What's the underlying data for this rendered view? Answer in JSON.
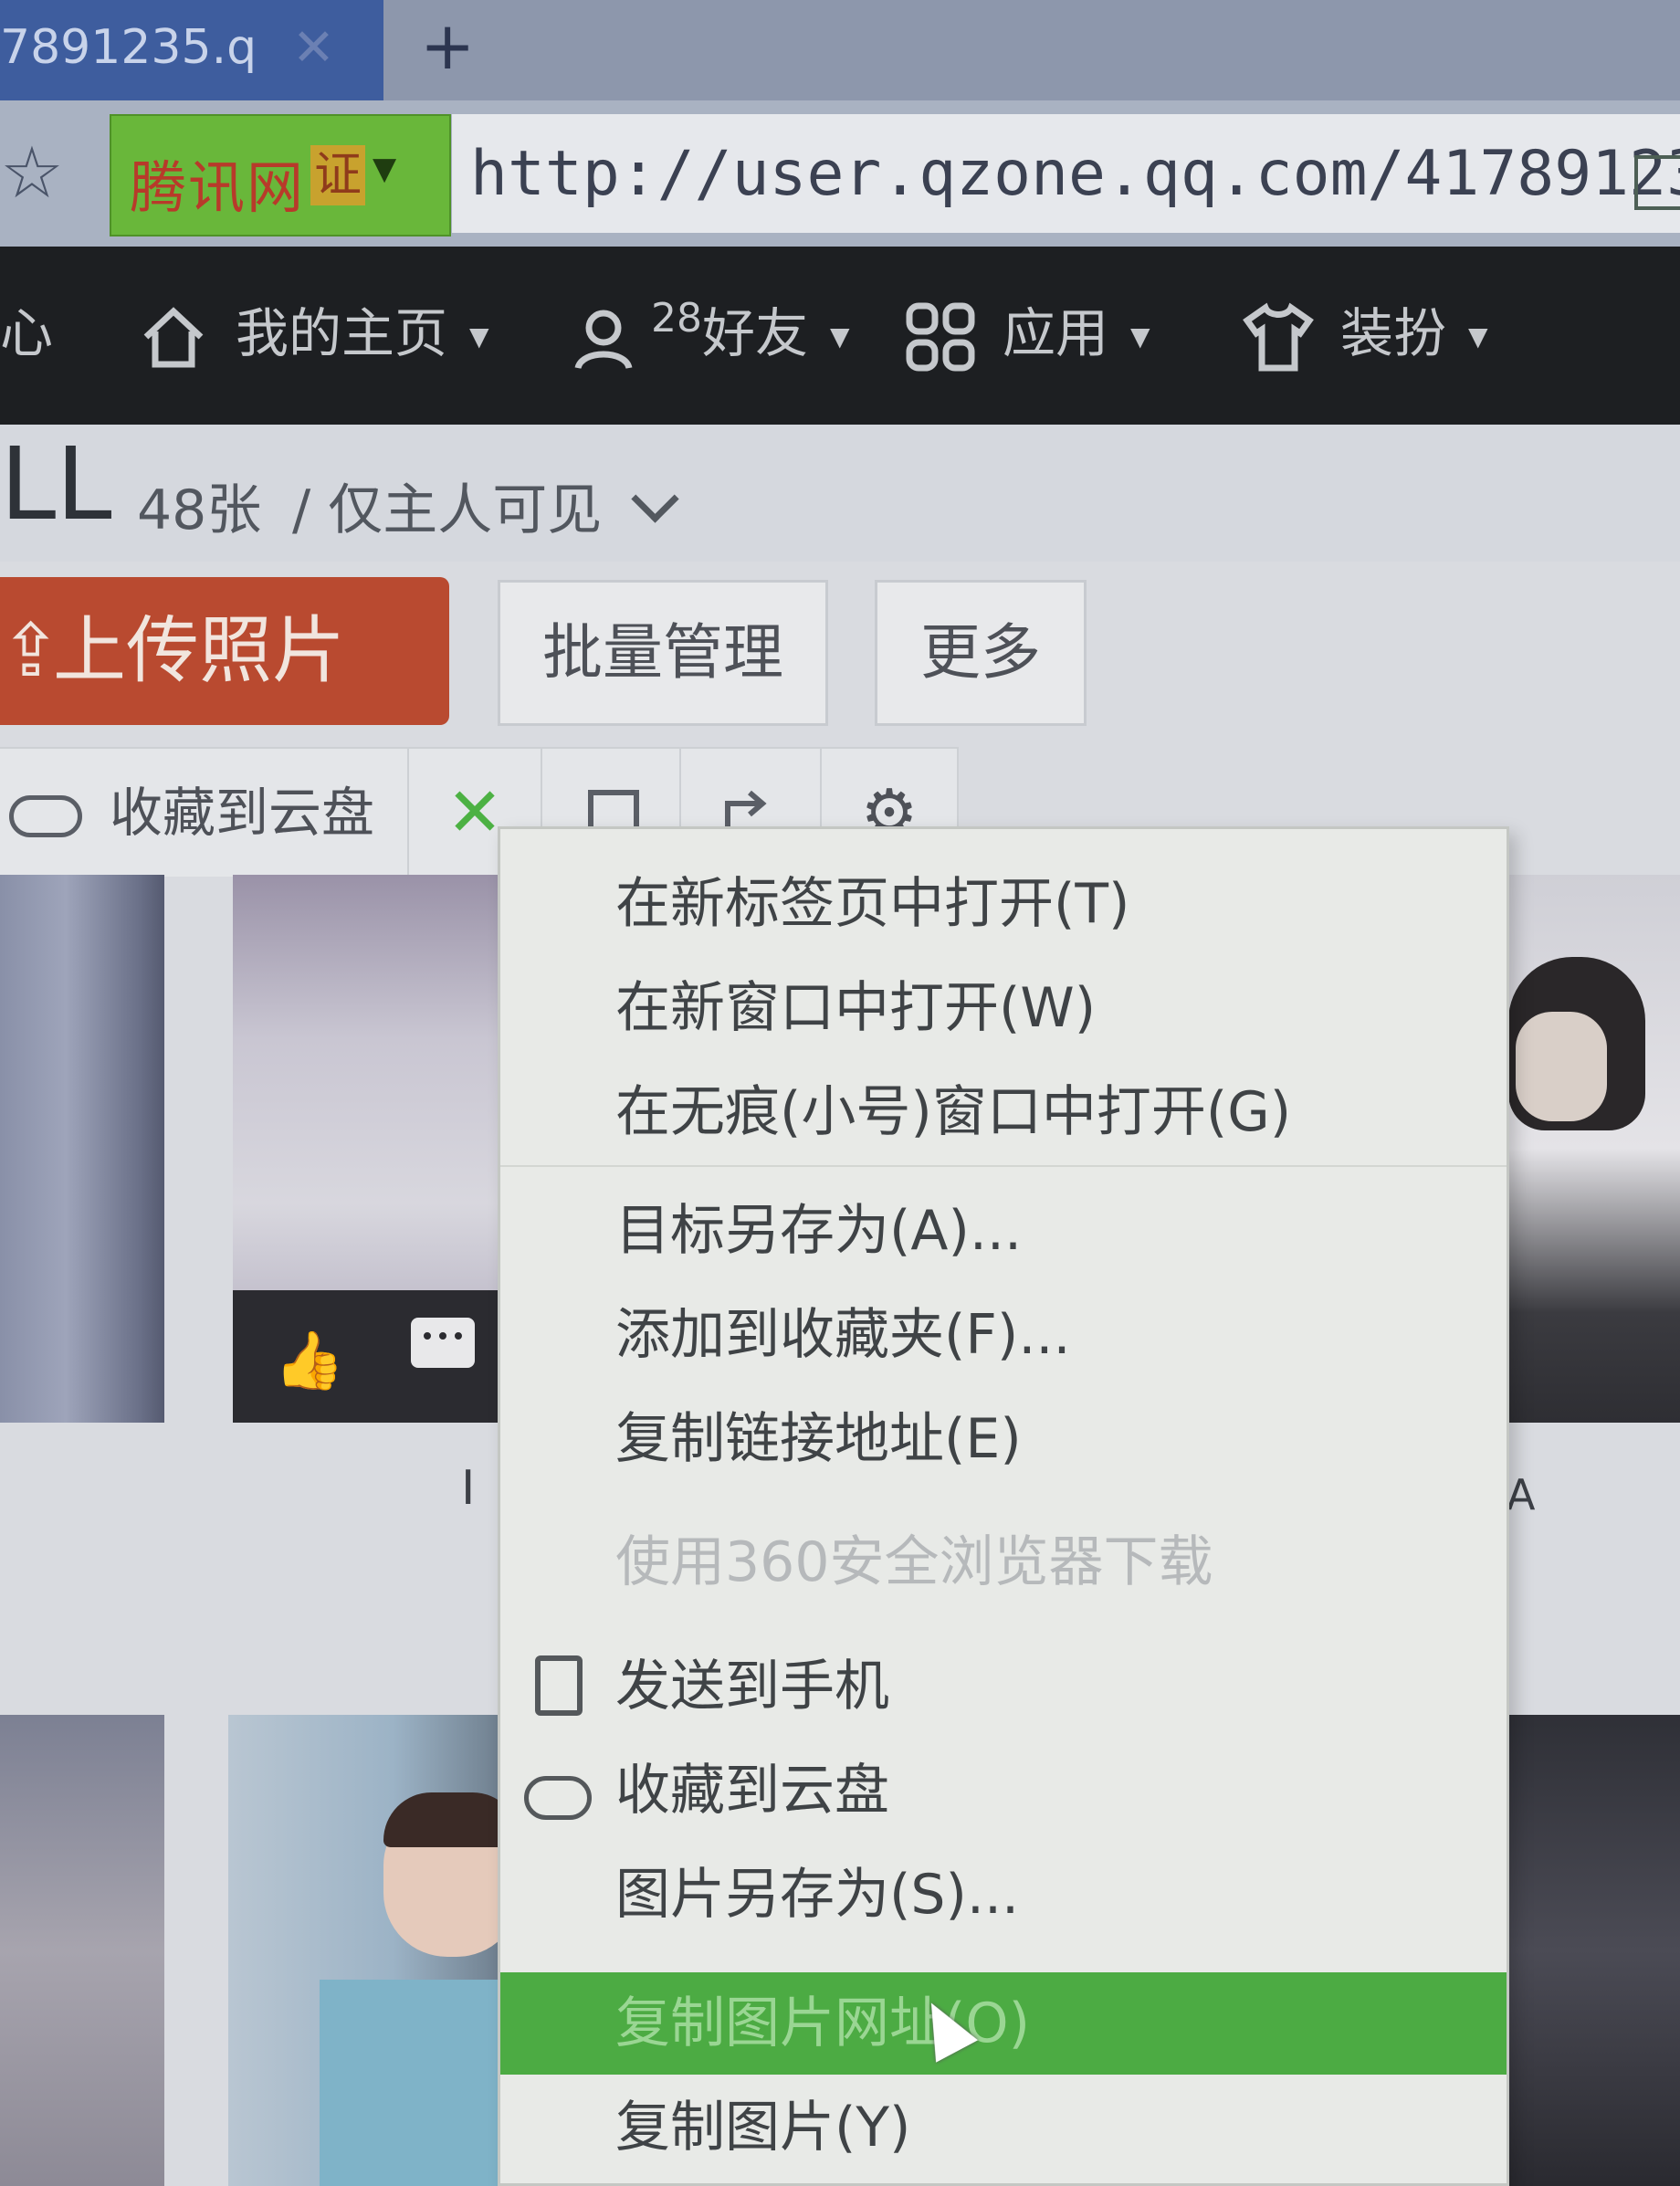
{
  "browser": {
    "tab_title": "7891235.q",
    "tab_close": "✕",
    "new_tab": "+",
    "site_badge_name": "腾讯网",
    "site_badge_cert": "证",
    "url": "http://user.qzone.qq.com/41789123"
  },
  "topnav": {
    "cut_item": "心",
    "home": "我的主页",
    "friends_count": "28",
    "friends": "好友",
    "apps": "应用",
    "dress": "装扮"
  },
  "album": {
    "count": "48张",
    "privacy": "/ 仅主人可见"
  },
  "actions": {
    "upload": "上传照片",
    "batch": "批量管理",
    "more": "更多"
  },
  "toolbar": {
    "save_cloud": "收藏到云盘",
    "close_symbol": "✕",
    "gear_symbol": "⚙"
  },
  "captions": {
    "left": "I",
    "right": "A"
  },
  "context_menu": {
    "items": [
      {
        "label": "在新标签页中打开(T)"
      },
      {
        "label": "在新窗口中打开(W)"
      },
      {
        "label": "在无痕(小号)窗口中打开(G)"
      },
      {
        "label": "目标另存为(A)..."
      },
      {
        "label": "添加到收藏夹(F)..."
      },
      {
        "label": "复制链接地址(E)"
      },
      {
        "label": "使用360安全浏览器下载"
      },
      {
        "label": "发送到手机"
      },
      {
        "label": "收藏到云盘"
      },
      {
        "label": "图片另存为(S)..."
      },
      {
        "label": "复制图片网址(O)"
      },
      {
        "label": "复制图片(Y)"
      }
    ]
  },
  "colors": {
    "topnav_bg": "#1d1f22",
    "upload_btn": "#b94a30",
    "menu_highlight": "#4cab43",
    "site_badge": "#69b73a"
  }
}
